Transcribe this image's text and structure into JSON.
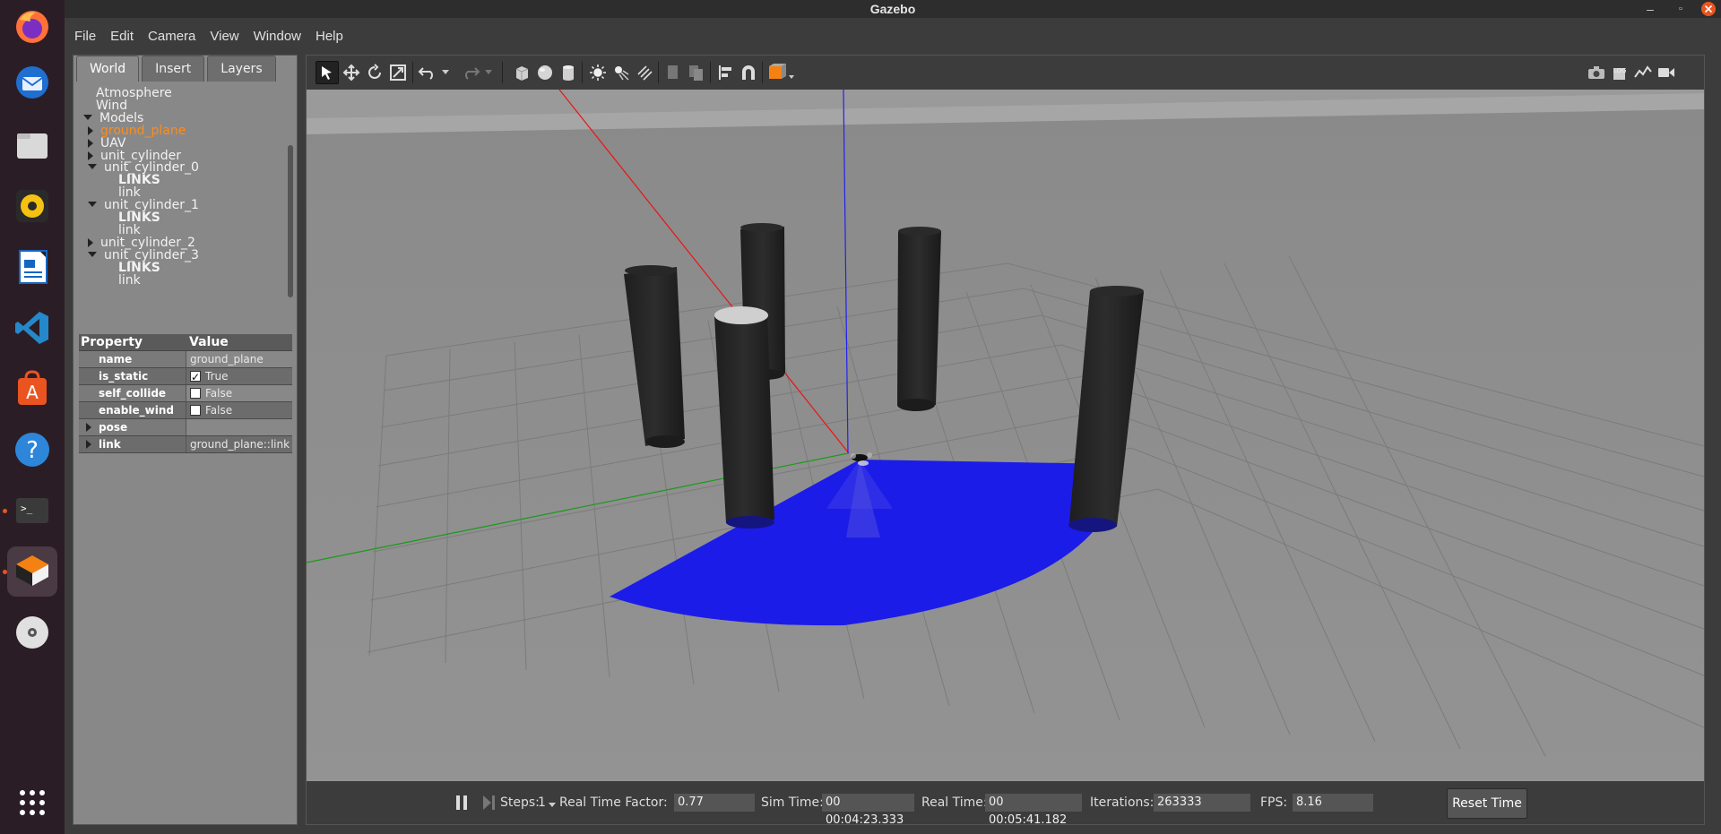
{
  "window": {
    "title": "Gazebo"
  },
  "menu": [
    "File",
    "Edit",
    "Camera",
    "View",
    "Window",
    "Help"
  ],
  "dock": {
    "items": [
      "firefox-icon",
      "thunderbird-icon",
      "files-icon",
      "rhythmbox-icon",
      "writer-icon",
      "vscode-icon",
      "software-center-icon",
      "help-icon",
      "terminal-icon",
      "gazebo-icon",
      "disc-icon",
      "app-grid-icon"
    ]
  },
  "tabs": [
    "World",
    "Insert",
    "Layers"
  ],
  "tree": [
    {
      "label": "Atmosphere",
      "indent": 0,
      "arrow": "none"
    },
    {
      "label": "Wind",
      "indent": 0,
      "arrow": "none"
    },
    {
      "label": "Models",
      "indent": 0,
      "arrow": "down"
    },
    {
      "label": "ground_plane",
      "indent": 1,
      "arrow": "right",
      "selected": true
    },
    {
      "label": "UAV",
      "indent": 1,
      "arrow": "right"
    },
    {
      "label": "unit_cylinder",
      "indent": 1,
      "arrow": "right"
    },
    {
      "label": "unit_cylinder_0",
      "indent": 1,
      "arrow": "down"
    },
    {
      "label": "LINKS",
      "indent": 2,
      "arrow": "none",
      "bold": true
    },
    {
      "label": "link",
      "indent": 2,
      "arrow": "none"
    },
    {
      "label": "unit_cylinder_1",
      "indent": 1,
      "arrow": "down"
    },
    {
      "label": "LINKS",
      "indent": 2,
      "arrow": "none",
      "bold": true
    },
    {
      "label": "link",
      "indent": 2,
      "arrow": "none"
    },
    {
      "label": "unit_cylinder_2",
      "indent": 1,
      "arrow": "right"
    },
    {
      "label": "unit_cylinder_3",
      "indent": 1,
      "arrow": "down"
    },
    {
      "label": "LINKS",
      "indent": 2,
      "arrow": "none",
      "bold": true
    },
    {
      "label": "link",
      "indent": 2,
      "arrow": "none"
    }
  ],
  "properties": {
    "header": {
      "property": "Property",
      "value": "Value"
    },
    "rows": [
      {
        "key": "name",
        "value": "ground_plane",
        "type": "text"
      },
      {
        "key": "is_static",
        "value": "True",
        "type": "check",
        "checked": true
      },
      {
        "key": "self_collide",
        "value": "False",
        "type": "check",
        "checked": false
      },
      {
        "key": "enable_wind",
        "value": "False",
        "type": "check",
        "checked": false
      },
      {
        "key": "pose",
        "value": "",
        "type": "expand"
      },
      {
        "key": "link",
        "value": "ground_plane::link",
        "type": "expand"
      }
    ]
  },
  "bottom": {
    "steps_label": "Steps:",
    "steps_value": "1",
    "rtf_label": "Real Time Factor:",
    "rtf_value": "0.77",
    "sim_label": "Sim Time:",
    "sim_value": "00 00:04:23.333",
    "real_label": "Real Time:",
    "real_value": "00 00:05:41.182",
    "iter_label": "Iterations:",
    "iter_value": "263333",
    "fps_label": "FPS:",
    "fps_value": "8.16",
    "reset_label": "Reset Time"
  },
  "colors": {
    "accent": "#ff8c1a",
    "laser": "#0000ff",
    "sky": "#9a9a9a",
    "ground": "#8c8c8c"
  }
}
